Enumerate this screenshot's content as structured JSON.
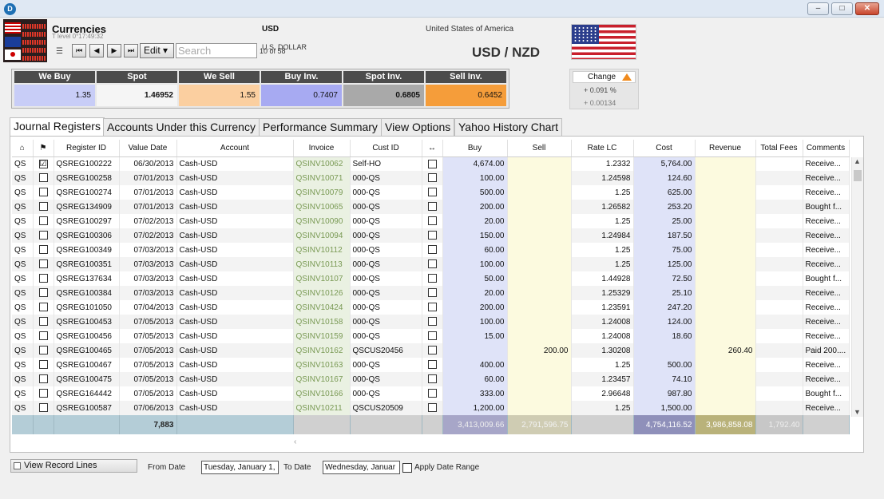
{
  "window": {
    "icon": "app-logo-icon",
    "min": "–",
    "max": "□",
    "close": "✕"
  },
  "header": {
    "title": "Currencies",
    "subtitle": "T level 0°17:49:32",
    "edit_label": "Edit ▾",
    "search_placeholder": "Search",
    "counter": "10 of 58",
    "currency_code": "USD",
    "currency_name": "U.S. DOLLAR",
    "country": "United States of America",
    "pair_left": "USD",
    "pair_sep": "/",
    "pair_right": "NZD"
  },
  "rates": {
    "we_buy": {
      "label": "We Buy",
      "value": "1.35",
      "color": "#c8cdf7"
    },
    "spot": {
      "label": "Spot",
      "value": "1.46952",
      "color": "#f5f5f5"
    },
    "we_sell": {
      "label": "We Sell",
      "value": "1.55",
      "color": "#fbcfa0"
    },
    "buy_inv": {
      "label": "Buy Inv.",
      "value": "0.7407",
      "color": "#a7aaf2"
    },
    "spot_inv": {
      "label": "Spot Inv.",
      "value": "0.6805",
      "color": "#a9a9a9"
    },
    "sell_inv": {
      "label": "Sell Inv.",
      "value": "0.6452",
      "color": "#f59d3a"
    }
  },
  "change": {
    "label": "Change",
    "percent": "+ 0.091 %",
    "abs": "+ 0.00134"
  },
  "tabs": [
    "Journal Registers",
    "Accounts Under this Currency",
    "Performance Summary",
    "View Options",
    "Yahoo History Chart"
  ],
  "columns": [
    "",
    "",
    "Register ID",
    "Value Date",
    "Account",
    "Invoice",
    "Cust ID",
    "↔",
    "Buy",
    "Sell",
    "Rate LC",
    "Cost",
    "Revenue",
    "Total Fees",
    "Comments"
  ],
  "rows": [
    [
      "QS",
      "☑",
      "QSREG100222",
      "06/30/2013",
      "Cash-USD",
      "QSINV10062",
      "Self-HO",
      "",
      "4,674.00",
      "",
      "1.2332",
      "5,764.00",
      "",
      "",
      "Receive..."
    ],
    [
      "QS",
      "",
      "QSREG100258",
      "07/01/2013",
      "Cash-USD",
      "QSINV10071",
      "000-QS",
      "",
      "100.00",
      "",
      "1.24598",
      "124.60",
      "",
      "",
      "Receive..."
    ],
    [
      "QS",
      "",
      "QSREG100274",
      "07/01/2013",
      "Cash-USD",
      "QSINV10079",
      "000-QS",
      "",
      "500.00",
      "",
      "1.25",
      "625.00",
      "",
      "",
      "Receive..."
    ],
    [
      "QS",
      "",
      "QSREG134909",
      "07/01/2013",
      "Cash-USD",
      "QSINV10065",
      "000-QS",
      "",
      "200.00",
      "",
      "1.26582",
      "253.20",
      "",
      "",
      "Bought f..."
    ],
    [
      "QS",
      "",
      "QSREG100297",
      "07/02/2013",
      "Cash-USD",
      "QSINV10090",
      "000-QS",
      "",
      "20.00",
      "",
      "1.25",
      "25.00",
      "",
      "",
      "Receive..."
    ],
    [
      "QS",
      "",
      "QSREG100306",
      "07/02/2013",
      "Cash-USD",
      "QSINV10094",
      "000-QS",
      "",
      "150.00",
      "",
      "1.24984",
      "187.50",
      "",
      "",
      "Receive..."
    ],
    [
      "QS",
      "",
      "QSREG100349",
      "07/03/2013",
      "Cash-USD",
      "QSINV10112",
      "000-QS",
      "",
      "60.00",
      "",
      "1.25",
      "75.00",
      "",
      "",
      "Receive..."
    ],
    [
      "QS",
      "",
      "QSREG100351",
      "07/03/2013",
      "Cash-USD",
      "QSINV10113",
      "000-QS",
      "",
      "100.00",
      "",
      "1.25",
      "125.00",
      "",
      "",
      "Receive..."
    ],
    [
      "QS",
      "",
      "QSREG137634",
      "07/03/2013",
      "Cash-USD",
      "QSINV10107",
      "000-QS",
      "",
      "50.00",
      "",
      "1.44928",
      "72.50",
      "",
      "",
      "Bought f..."
    ],
    [
      "QS",
      "",
      "QSREG100384",
      "07/03/2013",
      "Cash-USD",
      "QSINV10126",
      "000-QS",
      "",
      "20.00",
      "",
      "1.25329",
      "25.10",
      "",
      "",
      "Receive..."
    ],
    [
      "QS",
      "",
      "QSREG101050",
      "07/04/2013",
      "Cash-USD",
      "QSINV10424",
      "000-QS",
      "",
      "200.00",
      "",
      "1.23591",
      "247.20",
      "",
      "",
      "Receive..."
    ],
    [
      "QS",
      "",
      "QSREG100453",
      "07/05/2013",
      "Cash-USD",
      "QSINV10158",
      "000-QS",
      "",
      "100.00",
      "",
      "1.24008",
      "124.00",
      "",
      "",
      "Receive..."
    ],
    [
      "QS",
      "",
      "QSREG100456",
      "07/05/2013",
      "Cash-USD",
      "QSINV10159",
      "000-QS",
      "",
      "15.00",
      "",
      "1.24008",
      "18.60",
      "",
      "",
      "Receive..."
    ],
    [
      "QS",
      "",
      "QSREG100465",
      "07/05/2013",
      "Cash-USD",
      "QSINV10162",
      "QSCUS20456",
      "",
      "",
      "200.00",
      "1.30208",
      "",
      "260.40",
      "",
      "Paid 200...."
    ],
    [
      "QS",
      "",
      "QSREG100467",
      "07/05/2013",
      "Cash-USD",
      "QSINV10163",
      "000-QS",
      "",
      "400.00",
      "",
      "1.25",
      "500.00",
      "",
      "",
      "Receive..."
    ],
    [
      "QS",
      "",
      "QSREG100475",
      "07/05/2013",
      "Cash-USD",
      "QSINV10167",
      "000-QS",
      "",
      "60.00",
      "",
      "1.23457",
      "74.10",
      "",
      "",
      "Receive..."
    ],
    [
      "QS",
      "",
      "QSREG164442",
      "07/05/2013",
      "Cash-USD",
      "QSINV10166",
      "000-QS",
      "",
      "333.00",
      "",
      "2.96648",
      "987.80",
      "",
      "",
      "Bought f..."
    ],
    [
      "QS",
      "",
      "QSREG100587",
      "07/06/2013",
      "Cash-USD",
      "QSINV10211",
      "QSCUS20509",
      "",
      "1,200.00",
      "",
      "1.25",
      "1,500.00",
      "",
      "",
      "Receive..."
    ]
  ],
  "totals": {
    "count": "7,883",
    "buy": "3,413,009.66",
    "sell": "2,791,596.75",
    "cost": "4,754,116.52",
    "revenue": "3,986,858.08",
    "fees": "1,792.40"
  },
  "bottom": {
    "view_record_lines": "View Record Lines",
    "from_date_label": "From Date",
    "from_date_value": "Tuesday, January 1,",
    "to_date_label": "To Date",
    "to_date_value": "Wednesday, Januar",
    "apply_label": "Apply Date Range"
  }
}
